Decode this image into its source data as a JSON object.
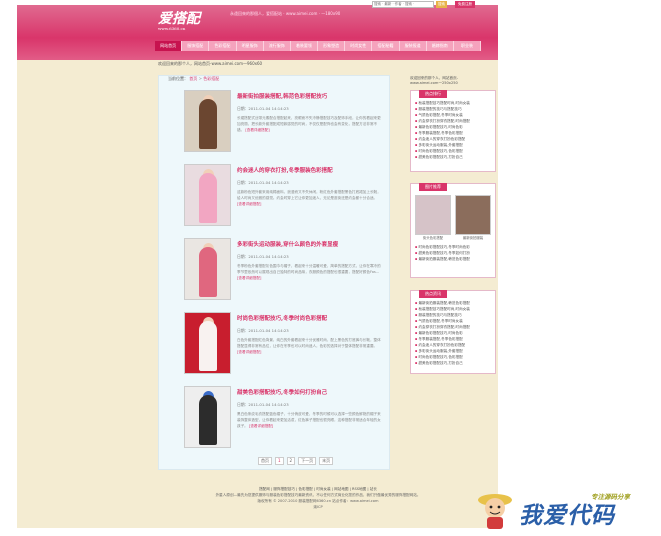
{
  "header": {
    "logo_text": "爱搭配",
    "logo_sub": "www.6360.cn",
    "slogan": "永遠回來的那個人，爱搭配站 · www.aimei.com · 一180x90",
    "search_placeholder": "搜索 · 最新 · 作者 · 搜索 ·",
    "search_button": "搜索",
    "register_link": "免费注册"
  },
  "nav": {
    "items": [
      "网站首页",
      "服饰搭配",
      "色彩搭配",
      "明星服饰",
      "流行服饰",
      "着装要领",
      "形象塑造",
      "时尚女性",
      "搭配秘籍",
      "服装报道",
      "婚嫁指南",
      "职业装"
    ],
    "active_index": 0
  },
  "ad_top": "欢迎回来的那个人，网站首页-www.aimei.com一960x60",
  "breadcrumb": {
    "label": "当前位置：",
    "home": "首页",
    "sep": ">",
    "current": "色彩搭配"
  },
  "articles": [
    {
      "title": "最新街拍服装搭配,韩范色彩搭配技巧",
      "date": "日期：2011-01-04 14:14:23",
      "desc": "长裙搭配式丝带元素配合搭配起来，亮眼而不失冷静搭配技巧及配饰手段，让你的看起来更加亮丽，把长款外套搭配成短款感觉的时尚，不仅仅是配饰也会有变化，搭配方法非常不错。",
      "more": "[查看详细搭配]",
      "dress_color": "#6b4630"
    },
    {
      "title": "约会迷人的穿衣打扮,冬季服装色彩搭配",
      "date": "日期：2011-01-04 14:14:23",
      "desc": "这款粉色短外套采用纯棉面料，浪漫而又不失休闲，粉红色外套搭配黑色打底裙加上长靴，给人时尚又优雅的感觉。约会时穿上它让你更加迷人，无论是逛街还是约会都十分合适。",
      "more": "[查看详细搭配]",
      "dress_color": "#f2a6c2"
    },
    {
      "title": "多彩街头运动服装,穿什么颜色的外套显瘦",
      "date": "日期：2011-01-04 14:14:23",
      "desc": "冬季粉色外套搭配灰色围巾与帽子，看起来十分温暖可爱，简单的搭配方式，让你在寒冷的季节里依然可以展现出自己独特的时尚品味，衣服颜色的搭配也很重要，搭配好颜色Fas...",
      "more": "[查看详细搭配]",
      "dress_color": "#e0677f"
    },
    {
      "title": "时尚色彩搭配技巧,冬季时尚色彩搭配",
      "date": "日期：2011-01-04 14:14:23",
      "desc": "白色外套搭配红色背景，纯白的外套看起来十分优雅时尚，配上黑色的打底裤与长靴，整体搭配显得非常有品位，让你在冬季也可以时尚迷人，色彩的选择对于整体搭配非常重要。",
      "more": "[查看详细搭配]",
      "dress_color": "#f8f2f0"
    },
    {
      "title": "甜美色彩搭配技巧,冬季如何打扮自己",
      "date": "日期：2011-01-04 14:14:23",
      "desc": "黑白色条纹毛衣搭配蓝色帽子，十分俏皮可爱，冬季的时候可以选择一些颜色鲜艳的帽子来装饰整体造型，让你看起来更加活泼，红色裤子搭配也很亮眼，这种搭配非常适合年轻的女孩子。",
      "more": "[查看详细搭配]",
      "dress_color": "#2c2c2c"
    }
  ],
  "pager": [
    "首页",
    "1",
    "2",
    "下一页",
    "末页"
  ],
  "sidebar": {
    "ad_text": [
      "欢迎回来的那个人，网站首页-",
      "www.aimei.com一250x250"
    ],
    "hot_title": "热点排行",
    "hot_items": [
      "秋装搭配技巧搭配时尚,时尚女装",
      "服装搭配的技巧与搭配技巧",
      "气质色彩搭配,冬季时尚女装",
      "约会穿衣打扮穿衣搭配,时尚搭配",
      "最新色彩搭配技巧,时尚色彩",
      "冬季服装搭配,冬季色彩搭配",
      "约会迷人的穿衣打扮色彩搭配",
      "多彩街头运动服装,外套搭配",
      "时尚色彩搭配技巧,色彩搭配",
      "甜美色彩搭配技巧,打扮自己"
    ],
    "photo_title": "图片推荐",
    "photo_captions": [
      "街头色彩搭配",
      "最新街拍服装"
    ],
    "photo_list": [
      "时尚色彩搭配技巧,冬季时尚色彩",
      "甜美色彩搭配技巧,冬季如何打扮",
      "最新街拍服装搭配,韩范色彩搭配",
      "冬季服装搭配,冬季色彩搭配技巧",
      "约会迷人的穿衣打扮,冬季服装"
    ],
    "hot2_title": "热点资讯",
    "hot2_items": [
      "最新街拍服装搭配,韩范色彩搭配",
      "秋装搭配技巧搭配时尚,时尚女装",
      "服装搭配的技巧与搭配技巧",
      "气质色彩搭配,冬季时尚女装",
      "约会穿衣打扮穿衣搭配,时尚搭配",
      "最新色彩搭配技巧,时尚色彩",
      "冬季服装搭配,冬季色彩搭配",
      "约会迷人的穿衣打扮色彩搭配",
      "多彩街头运动服装,外套搭配",
      "时尚色彩搭配技巧,色彩搭配",
      "甜美色彩搭配技巧,打扮自己"
    ]
  },
  "footer": {
    "links": "搭配网 | 服饰搭配技巧 | 色彩搭配 | 时尚女装 | 网站地图 | RSS地图 | 站长",
    "line2": "外星人原创—最先为您提供服饰与服装色彩搭配技巧最新资讯，不以任何方式商业化您的作品，我们只做最优秀的服饰搭配网站。",
    "line3": "版权所有 © 2007-2010 服装搭配网6360.cn 站点作者：www.aimei.com",
    "line4": "渝ICP"
  },
  "watermark": {
    "text": "我爱代码",
    "tagline": "专注源码分享"
  }
}
